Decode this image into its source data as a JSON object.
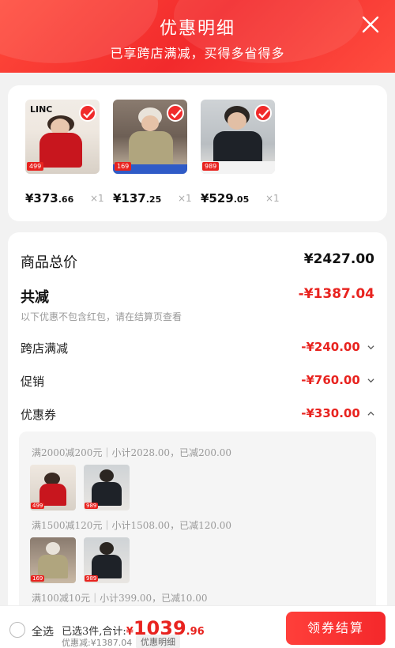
{
  "header": {
    "title": "优惠明细",
    "subtitle": "已享跨店满减，买得多省得多"
  },
  "products": [
    {
      "brand": "LINC",
      "tag": "499",
      "price_int": "¥373",
      "price_dec": ".66",
      "qty": "×1"
    },
    {
      "tag": "169",
      "price_int": "¥137",
      "price_dec": ".25",
      "qty": "×1"
    },
    {
      "tag": "989",
      "price_int": "¥529",
      "price_dec": ".05",
      "qty": "×1"
    }
  ],
  "summary": {
    "total_label": "商品总价",
    "total_value": "¥2427.00",
    "reduce_label": "共减",
    "reduce_value": "-¥1387.04",
    "note": "以下优惠不包含红包，请在结算页查看",
    "cross_store_label": "跨店满减",
    "cross_store_value": "-¥240.00",
    "promo_label": "促销",
    "promo_value": "-¥760.00",
    "coupon_label": "优惠券",
    "coupon_value": "-¥330.00"
  },
  "coupons": [
    {
      "text": "满2000减200元｜小计2028.00，已减200.00"
    },
    {
      "text": "满1500减120元｜小计1508.00，已减120.00"
    },
    {
      "text": "满100减10元｜小计399.00，已减10.00"
    }
  ],
  "bottom": {
    "select_all": "全选",
    "selected_text": "已选3件,合计:",
    "currency": "¥",
    "sum_int": "1039",
    "sum_dec": ".96",
    "discount_text": "优惠减:¥1387.04",
    "discount_badge": "优惠明细",
    "checkout_label": "领券结算"
  },
  "colors": {
    "accent": "#e8231f",
    "header": "#f22a2c"
  }
}
